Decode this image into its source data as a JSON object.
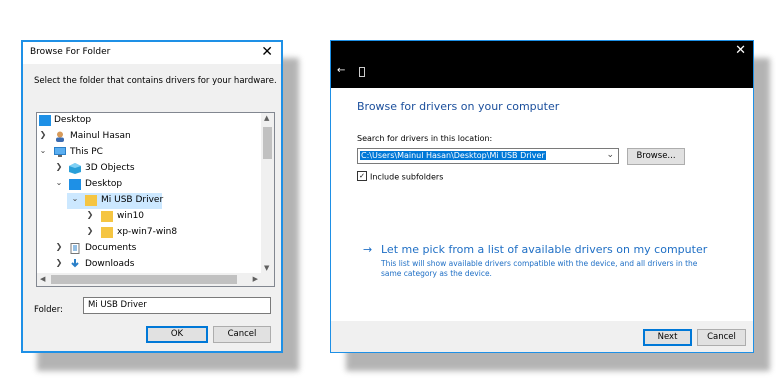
{
  "browse_dialog": {
    "title": "Browse For Folder",
    "instruction": "Select the folder that contains drivers for your hardware.",
    "tree": [
      {
        "label": "Desktop",
        "icon": "desktop-icon",
        "expander": ""
      },
      {
        "label": "Mainul Hasan",
        "icon": "user-icon",
        "expander": ">"
      },
      {
        "label": "This PC",
        "icon": "computer-icon",
        "expander": "v"
      },
      {
        "label": "3D Objects",
        "icon": "cube-icon",
        "expander": ">"
      },
      {
        "label": "Desktop",
        "icon": "desktop-icon",
        "expander": "v"
      },
      {
        "label": "Mi USB Driver",
        "icon": "folder-icon",
        "expander": "v",
        "selected": true
      },
      {
        "label": "win10",
        "icon": "folder-icon",
        "expander": ">"
      },
      {
        "label": "xp-win7-win8",
        "icon": "folder-icon",
        "expander": ">"
      },
      {
        "label": "Documents",
        "icon": "documents-icon",
        "expander": ">"
      },
      {
        "label": "Downloads",
        "icon": "download-icon",
        "expander": ">"
      }
    ],
    "folder_label": "Folder:",
    "folder_value": "Mi USB Driver",
    "ok_label": "OK",
    "cancel_label": "Cancel"
  },
  "driver_dialog": {
    "heading": "Browse for drivers on your computer",
    "search_label": "Search for drivers in this location:",
    "path_value": "C:\\Users\\Mainul Hasan\\Desktop\\Mi USB Driver",
    "browse_label": "Browse...",
    "include_subfolders_label": "Include subfolders",
    "include_subfolders_checked": true,
    "pick_link": "Let me pick from a list of available drivers on my computer",
    "pick_description": "This list will show available drivers compatible with the device, and all drivers in the same category as the device.",
    "next_label": "Next",
    "cancel_label": "Cancel"
  },
  "colors": {
    "accent": "#0078d7",
    "link": "#1f6fc5",
    "heading": "#1b4f9c",
    "selection": "#cce8ff",
    "folder": "#f5c542"
  }
}
